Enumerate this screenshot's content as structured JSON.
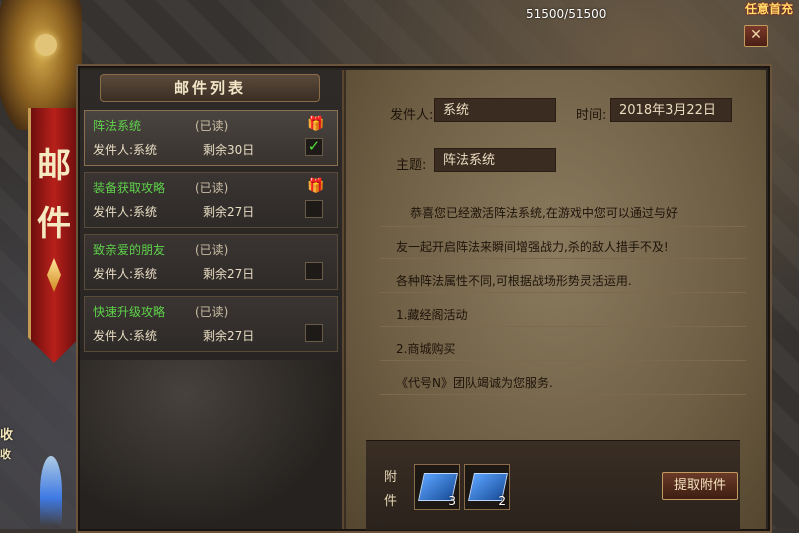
{
  "hud": {
    "hp": "51500/51500",
    "banner_text": "任意首充"
  },
  "side_banner": {
    "chars": [
      "邮",
      "件"
    ]
  },
  "left_edge_text": [
    "收",
    "收"
  ],
  "list": {
    "title": "邮件列表",
    "items": [
      {
        "title": "阵法系统",
        "status": "(已读)",
        "sender": "发件人:系统",
        "remain": "剩余30日",
        "has_gift": true,
        "checked": true,
        "selected": true
      },
      {
        "title": "装备获取攻略",
        "status": "(已读)",
        "sender": "发件人:系统",
        "remain": "剩余27日",
        "has_gift": true,
        "checked": false,
        "selected": false
      },
      {
        "title": "致亲爱的朋友",
        "status": "(已读)",
        "sender": "发件人:系统",
        "remain": "剩余27日",
        "has_gift": false,
        "checked": false,
        "selected": false
      },
      {
        "title": "快速升级攻略",
        "status": "(已读)",
        "sender": "发件人:系统",
        "remain": "剩余27日",
        "has_gift": false,
        "checked": false,
        "selected": false
      }
    ]
  },
  "detail": {
    "sender_label": "发件人:",
    "sender_value": "系统",
    "time_label": "时间:",
    "time_value": "2018年3月22日",
    "subject_label": "主题:",
    "subject_value": "阵法系统",
    "body": [
      "恭喜您已经激活阵法系统,在游戏中您可以通过与好",
      "友一起开启阵法来瞬间增强战力,杀的敌人措手不及!",
      "各种阵法属性不同,可根据战场形势灵活运用.",
      "1.藏经阁活动",
      "2.商城购买",
      "《代号N》团队竭诚为您服务."
    ]
  },
  "attachments": {
    "label_chars": [
      "附",
      "件"
    ],
    "items": [
      {
        "icon": "book-icon",
        "count": "3"
      },
      {
        "icon": "book-icon",
        "count": "2"
      }
    ],
    "claim_label": "提取附件"
  },
  "colors": {
    "title_green": "#5ed24a",
    "parchment": "#7a6a50",
    "banner_red": "#b8201a"
  }
}
